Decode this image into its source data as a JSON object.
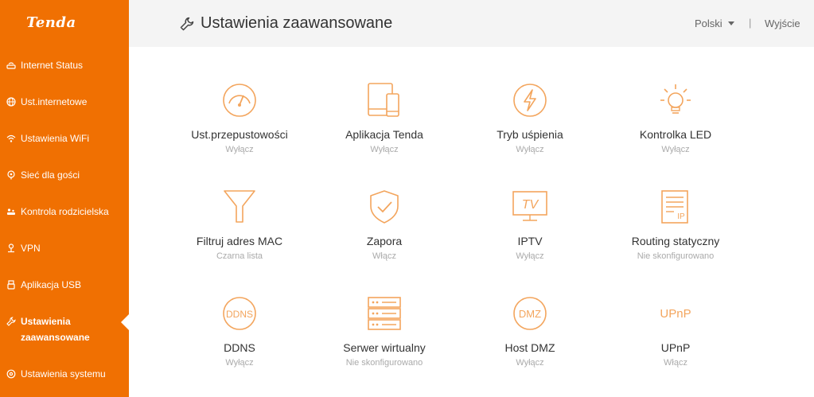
{
  "brand": {
    "logo_text": "Tenda",
    "accent": "#f07002",
    "icon_color": "#f3a55d"
  },
  "sidebar": {
    "items": [
      {
        "label": "Internet Status",
        "icon": "router-icon"
      },
      {
        "label": "Ust.internetowe",
        "icon": "globe-icon"
      },
      {
        "label": "Ustawienia WiFi",
        "icon": "wifi-icon"
      },
      {
        "label": "Sieć dla gości",
        "icon": "guest-network-icon"
      },
      {
        "label": "Kontrola rodzicielska",
        "icon": "parental-control-icon"
      },
      {
        "label": "VPN",
        "icon": "vpn-icon"
      },
      {
        "label": "Aplikacja USB",
        "icon": "usb-icon"
      },
      {
        "label_line1": "Ustawienia",
        "label_line2": "zaawansowane",
        "icon": "wrench-icon",
        "active": true
      },
      {
        "label": "Ustawienia systemu",
        "icon": "system-settings-icon"
      }
    ]
  },
  "header": {
    "title": "Ustawienia zaawansowane",
    "language": "Polski",
    "separator": "|",
    "logout": "Wyjście"
  },
  "tiles": [
    {
      "name": "Ust.przepustowości",
      "status": "Wyłącz",
      "icon": "speedometer-icon"
    },
    {
      "name": "Aplikacja Tenda",
      "status": "Wyłącz",
      "icon": "tablet-phone-icon"
    },
    {
      "name": "Tryb uśpienia",
      "status": "Wyłącz",
      "icon": "lightning-icon"
    },
    {
      "name": "Kontrolka LED",
      "status": "Wyłącz",
      "icon": "bulb-icon"
    },
    {
      "name": "Filtruj adres MAC",
      "status": "Czarna lista",
      "icon": "funnel-icon"
    },
    {
      "name": "Zapora",
      "status": "Włącz",
      "icon": "shield-check-icon"
    },
    {
      "name": "IPTV",
      "status": "Wyłącz",
      "icon": "tv-icon",
      "icon_text": "TV"
    },
    {
      "name": "Routing statyczny",
      "status": "Nie skonfigurowano",
      "icon": "routing-table-icon",
      "icon_text": "IP"
    },
    {
      "name": "DDNS",
      "status": "Wyłącz",
      "icon": "ddns-icon",
      "icon_text": "DDNS"
    },
    {
      "name": "Serwer wirtualny",
      "status": "Nie skonfigurowano",
      "icon": "server-icon"
    },
    {
      "name": "Host DMZ",
      "status": "Wyłącz",
      "icon": "dmz-icon",
      "icon_text": "DMZ"
    },
    {
      "name": "UPnP",
      "status": "Włącz",
      "icon": "upnp-icon",
      "icon_text": "UPnP"
    }
  ]
}
